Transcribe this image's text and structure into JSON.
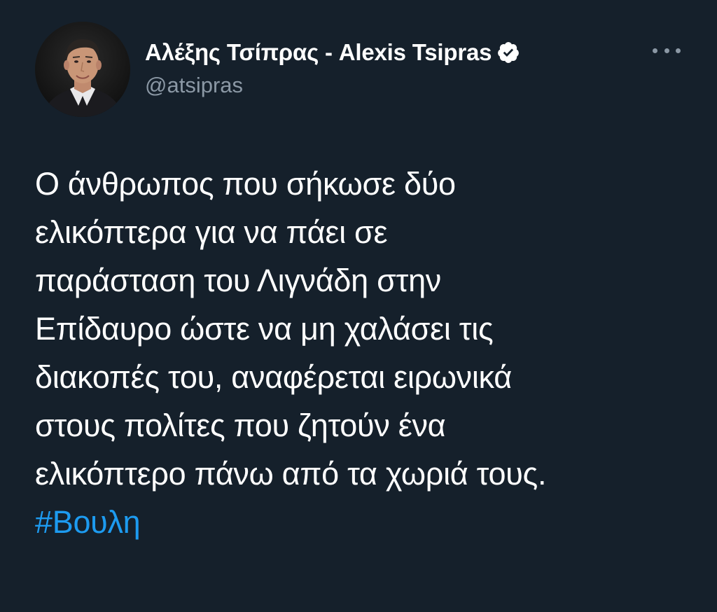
{
  "author": {
    "display_name": "Αλέξης Τσίπρας - Alexis Tsipras",
    "handle": "@atsipras",
    "verified": true,
    "avatar_icon": "profile-photo"
  },
  "menu": {
    "icon": "more-options-icon"
  },
  "tweet": {
    "lines": [
      "Ο άνθρωπος που σήκωσε δύο",
      "ελικόπτερα για να πάει σε",
      "παράσταση του Λιγνάδη στην",
      "Επίδαυρο ώστε να μη χαλάσει τις",
      "διακοπές του, αναφέρεται ειρωνικά",
      "στους πολίτες που ζητούν ένα",
      "ελικόπτερο πάνω από τα χωριά τους."
    ],
    "hashtag": "#Βουλη"
  },
  "colors": {
    "background": "#15202b",
    "text": "#ffffff",
    "secondary_text": "#8b98a5",
    "link": "#1d9bf0"
  }
}
